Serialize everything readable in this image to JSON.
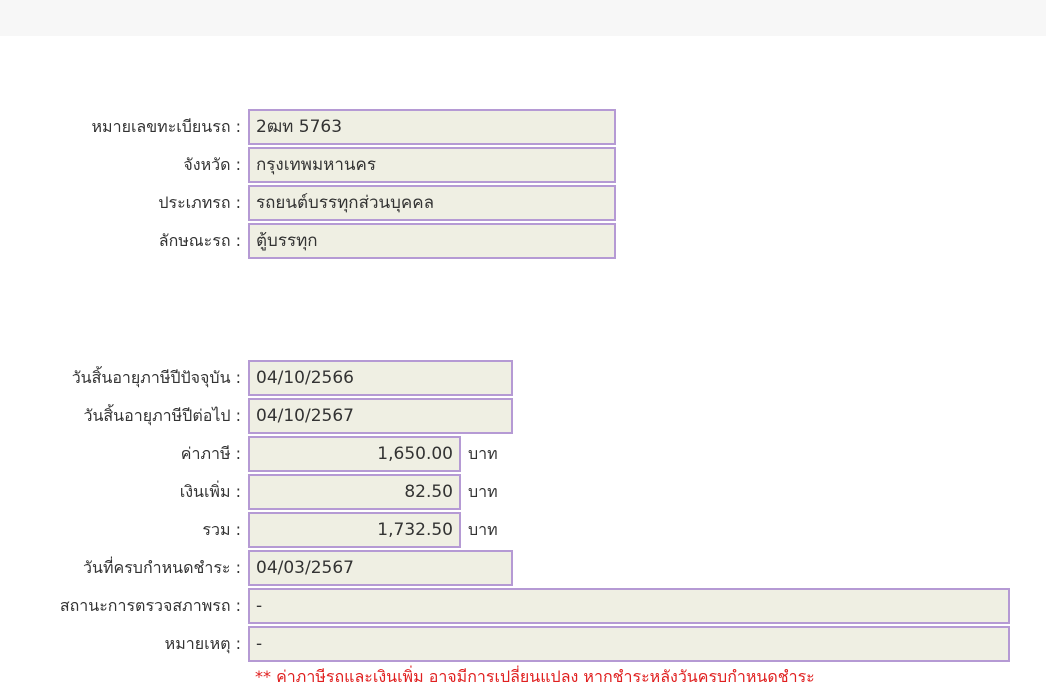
{
  "vehicle": {
    "plate": {
      "label": "หมายเลขทะเบียนรถ :",
      "value": "2ฒท 5763"
    },
    "province": {
      "label": "จังหวัด :",
      "value": "กรุงเทพมหานคร"
    },
    "type": {
      "label": "ประเภทรถ :",
      "value": "รถยนต์บรรทุกส่วนบุคคล"
    },
    "body": {
      "label": "ลักษณะรถ :",
      "value": "ตู้บรรทุก"
    }
  },
  "tax": {
    "current_expiry": {
      "label": "วันสิ้นอายุภาษีปีปัจจุบัน :",
      "value": "04/10/2566"
    },
    "next_expiry": {
      "label": "วันสิ้นอายุภาษีปีต่อไป :",
      "value": "04/10/2567"
    },
    "tax_amount": {
      "label": "ค่าภาษี :",
      "value": "1,650.00",
      "unit": "บาท"
    },
    "surcharge": {
      "label": "เงินเพิ่ม :",
      "value": "82.50",
      "unit": "บาท"
    },
    "total": {
      "label": "รวม :",
      "value": "1,732.50",
      "unit": "บาท"
    },
    "due_date": {
      "label": "วันที่ครบกำหนดชำระ :",
      "value": "04/03/2567"
    },
    "inspection": {
      "label": "สถานะการตรวจสภาพรถ :",
      "value": "-"
    },
    "remark": {
      "label": "หมายเหตุ :",
      "value": "-"
    }
  },
  "note": "** ค่าภาษีรถและเงินเพิ่ม อาจมีการเปลี่ยนแปลง หากชำระหลังวันครบกำหนดชำระ",
  "colors": {
    "field_border": "#b59ad4",
    "field_bg": "#efefe3",
    "note": "#e02020"
  }
}
